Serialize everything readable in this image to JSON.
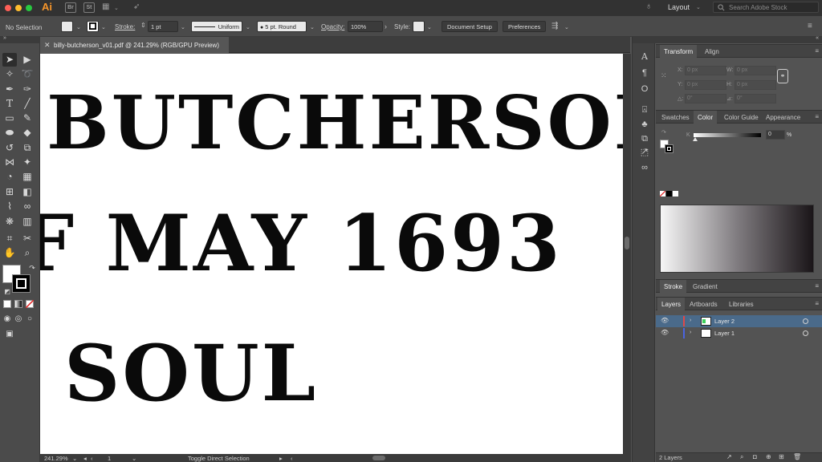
{
  "titlebar": {
    "app_logo": "Ai",
    "bridge": "Br",
    "stock": "St",
    "layout_label": "Layout",
    "search_placeholder": "Search Adobe Stock"
  },
  "controlbar": {
    "selection": "No Selection",
    "stroke_label": "Stroke:",
    "stroke_weight": "1 pt",
    "profile": "Uniform",
    "brush": "5 pt. Round",
    "opacity_label": "Opacity:",
    "opacity_value": "100%",
    "style_label": "Style:",
    "document_setup": "Document Setup",
    "preferences": "Preferences"
  },
  "document": {
    "tab_title": "billy-butcherson_v01.pdf @ 241.29% (RGB/GPU Preview)",
    "artwork_lines": [
      "BUTCHERSON",
      "F MAY 1693",
      "SOUL"
    ]
  },
  "status": {
    "zoom": "241.29%",
    "artboard_index": "1",
    "tool_hint": "Toggle Direct Selection"
  },
  "transform_panel": {
    "tabs": [
      "Transform",
      "Align"
    ],
    "x_label": "X:",
    "y_label": "Y:",
    "w_label": "W:",
    "h_label": "H:",
    "angle_label": "△:",
    "shear_label": "⊿:",
    "placeholder": "0 px",
    "angle_placeholder": "0°"
  },
  "color_panel": {
    "tabs": [
      "Swatches",
      "Color",
      "Color Guide",
      "Appearance"
    ],
    "k_label": "K",
    "k_value": "0",
    "percent": "%"
  },
  "stroke_panel": {
    "tabs": [
      "Stroke",
      "Gradient"
    ]
  },
  "layers_panel": {
    "tabs": [
      "Layers",
      "Artboards",
      "Libraries"
    ],
    "layers": [
      {
        "name": "Layer 2",
        "color": "#e04848"
      },
      {
        "name": "Layer 1",
        "color": "#4a64e0"
      }
    ],
    "footer_count": "2 Layers"
  },
  "colors": {
    "accent_orange": "#f7962a",
    "selected_layer": "#4a6a8a"
  }
}
